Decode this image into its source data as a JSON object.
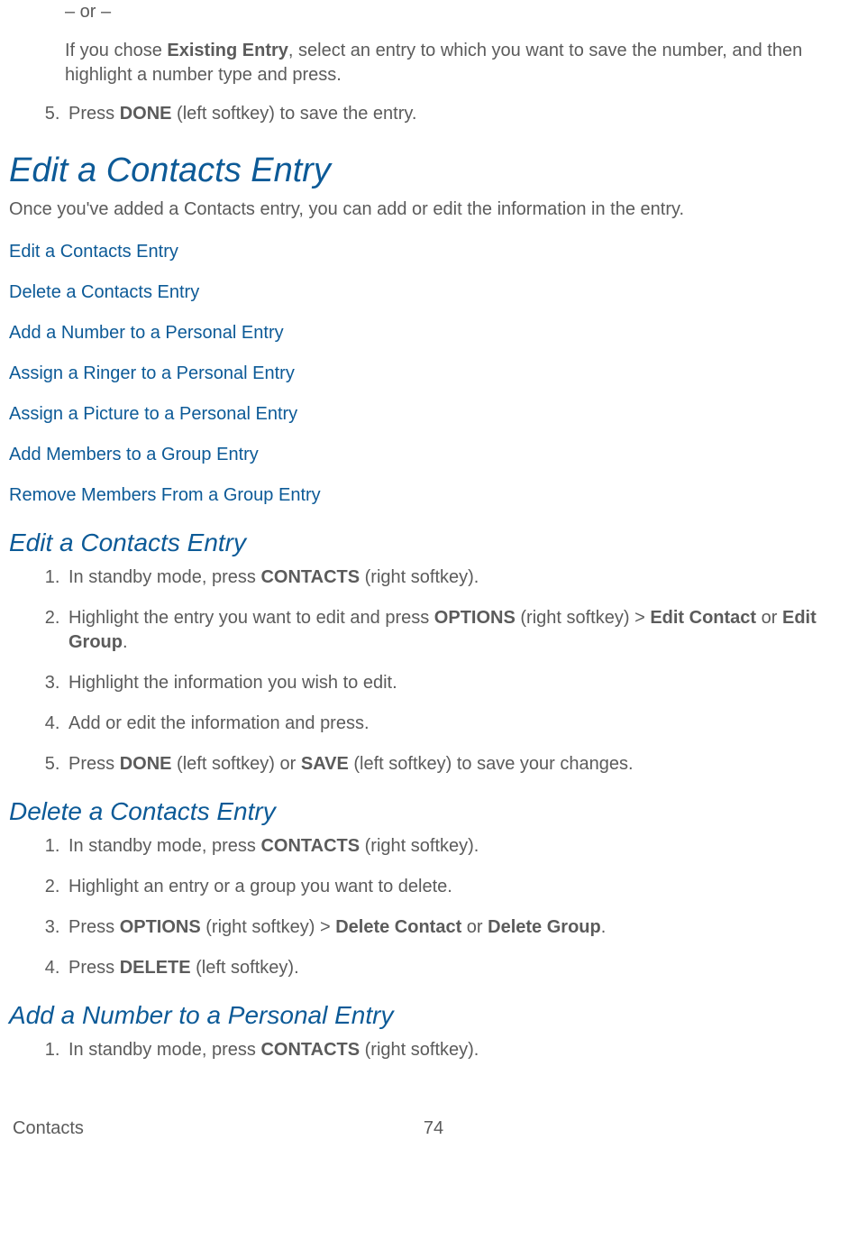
{
  "intro": {
    "or": "– or –",
    "p1a": "If you chose ",
    "p1b": "Existing Entry",
    "p1c": ", select an entry to which you want to save the number, and then highlight a number type and press."
  },
  "intro_list": {
    "item5a": "Press ",
    "item5b": "DONE",
    "item5c": " (left softkey) to save the entry."
  },
  "h1": "Edit a Contacts Entry",
  "lead": "Once you've added a Contacts entry, you can add or edit the information in the entry.",
  "toc": {
    "l1": "Edit a Contacts Entry",
    "l2": "Delete a Contacts Entry",
    "l3": "Add a Number to a Personal Entry",
    "l4": "Assign a Ringer to a Personal Entry",
    "l5": "Assign a Picture to a Personal Entry",
    "l6": "Add Members to a Group Entry",
    "l7": "Remove Members From a Group Entry"
  },
  "sec1": {
    "h": "Edit a Contacts Entry",
    "i1a": "In standby mode, press ",
    "i1b": "CONTACTS",
    "i1c": " (right softkey).",
    "i2a": "Highlight the entry you want to edit and press ",
    "i2b": "OPTIONS",
    "i2c": " (right softkey) > ",
    "i2d": "Edit Contact",
    "i2e": " or ",
    "i2f": "Edit Group",
    "i2g": ".",
    "i3": "Highlight the information you wish to edit.",
    "i4": "Add or edit the information and press.",
    "i5a": "Press ",
    "i5b": "DONE",
    "i5c": " (left softkey) or ",
    "i5d": "SAVE",
    "i5e": " (left softkey) to save your changes."
  },
  "sec2": {
    "h": "Delete a Contacts Entry",
    "i1a": "In standby mode, press ",
    "i1b": "CONTACTS",
    "i1c": " (right softkey).",
    "i2": "Highlight an entry or a group you want to delete.",
    "i3a": "Press ",
    "i3b": "OPTIONS",
    "i3c": " (right softkey) > ",
    "i3d": "Delete Contact",
    "i3e": " or ",
    "i3f": "Delete Group",
    "i3g": ".",
    "i4a": "Press ",
    "i4b": "DELETE",
    "i4c": " (left softkey)."
  },
  "sec3": {
    "h": "Add a Number to a Personal Entry",
    "i1a": "In standby mode, press ",
    "i1b": "CONTACTS",
    "i1c": " (right softkey)."
  },
  "footer": {
    "left": "Contacts",
    "page": "74"
  }
}
